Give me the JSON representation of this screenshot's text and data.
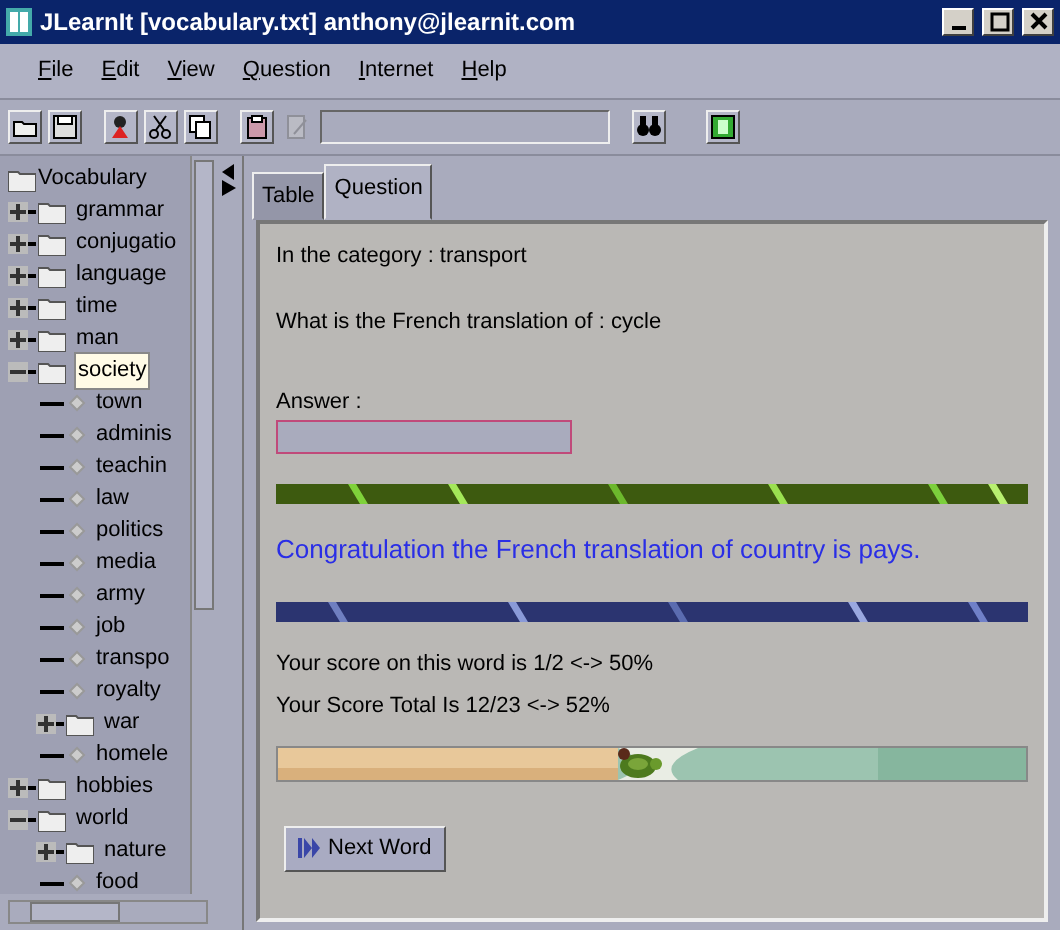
{
  "window": {
    "title": "JLearnIt [vocabulary.txt] anthony@jlearnit.com"
  },
  "menu": [
    {
      "label": "File"
    },
    {
      "label": "Edit"
    },
    {
      "label": "View"
    },
    {
      "label": "Question"
    },
    {
      "label": "Internet"
    },
    {
      "label": "Help"
    }
  ],
  "toolbar": [
    {
      "kind": "open",
      "disabled": false
    },
    {
      "kind": "save",
      "disabled": false
    },
    {
      "kind": "figure",
      "disabled": false
    },
    {
      "kind": "cut",
      "disabled": false
    },
    {
      "kind": "copy",
      "disabled": false
    },
    {
      "kind": "paste",
      "disabled": false
    },
    {
      "kind": "edit",
      "disabled": true
    },
    {
      "kind": "field",
      "disabled": false
    },
    {
      "kind": "find",
      "disabled": false
    },
    {
      "kind": "green",
      "disabled": false
    }
  ],
  "tree": {
    "label": "Vocabulary",
    "children": [
      {
        "label": "grammar",
        "kind": "folder",
        "expanded": false,
        "selected": false
      },
      {
        "label": "conjugatio",
        "kind": "folder",
        "expanded": false,
        "selected": false
      },
      {
        "label": "language",
        "kind": "folder",
        "expanded": false,
        "selected": false
      },
      {
        "label": "time",
        "kind": "folder",
        "expanded": false,
        "selected": false
      },
      {
        "label": "man",
        "kind": "folder",
        "expanded": false,
        "selected": false
      },
      {
        "label": "society",
        "kind": "folder",
        "expanded": true,
        "selected": true,
        "children": [
          {
            "label": "town",
            "kind": "leaf",
            "selected": false
          },
          {
            "label": "adminis",
            "kind": "leaf",
            "selected": false
          },
          {
            "label": "teachin",
            "kind": "leaf",
            "selected": false
          },
          {
            "label": "law",
            "kind": "leaf",
            "selected": false
          },
          {
            "label": "politics",
            "kind": "leaf",
            "selected": false
          },
          {
            "label": "media",
            "kind": "leaf",
            "selected": false
          },
          {
            "label": "army",
            "kind": "leaf",
            "selected": false
          },
          {
            "label": "job",
            "kind": "leaf",
            "selected": false
          },
          {
            "label": "transpo",
            "kind": "leaf",
            "selected": false
          },
          {
            "label": "royalty",
            "kind": "leaf",
            "selected": false
          },
          {
            "label": "war",
            "kind": "folder",
            "expanded": false,
            "selected": false
          },
          {
            "label": "homele",
            "kind": "leaf",
            "selected": false
          }
        ]
      },
      {
        "label": "hobbies",
        "kind": "folder",
        "expanded": false,
        "selected": false
      },
      {
        "label": "world",
        "kind": "folder",
        "expanded": true,
        "selected": false,
        "children": [
          {
            "label": "nature",
            "kind": "folder",
            "expanded": false,
            "selected": false
          },
          {
            "label": "food",
            "kind": "leaf",
            "selected": false
          }
        ]
      }
    ]
  },
  "tabs": [
    {
      "label": "Table",
      "selected": false
    },
    {
      "label": "Question",
      "selected": true
    }
  ],
  "question": {
    "category": "In the category : transport",
    "prompt": "What is the French translation of : cycle",
    "answer_label": "Answer :",
    "feedback": "Congratulation the French translation of country is pays.",
    "score_word": "Your score on this word is 1/2 <-> 50%",
    "score_total": "Your Score Total Is 12/23 <-> 52%",
    "progress": {
      "level": 0.48
    },
    "next_button": "Next Word"
  }
}
